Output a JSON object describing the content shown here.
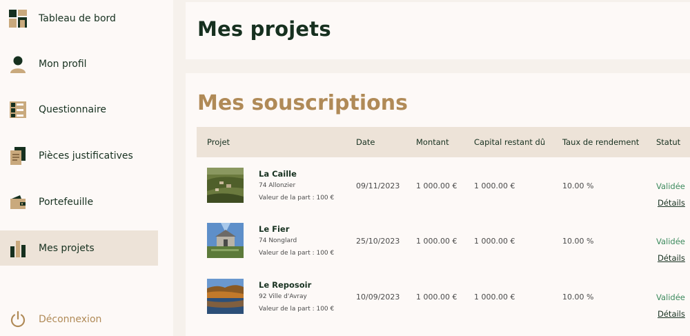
{
  "sidebar": {
    "items": [
      {
        "label": "Tableau de bord",
        "icon": "dashboard-icon"
      },
      {
        "label": "Mon profil",
        "icon": "user-icon"
      },
      {
        "label": "Questionnaire",
        "icon": "questionnaire-icon"
      },
      {
        "label": "Pièces justificatives",
        "icon": "documents-icon"
      },
      {
        "label": "Portefeuille",
        "icon": "wallet-icon"
      },
      {
        "label": "Mes projets",
        "icon": "bar-chart-icon",
        "active": true
      }
    ],
    "logout": {
      "label": "Déconnexion",
      "icon": "power-icon"
    }
  },
  "header": {
    "title": "Mes projets"
  },
  "subscriptions": {
    "title": "Mes souscriptions",
    "columns": [
      "Projet",
      "Date",
      "Montant",
      "Capital restant dû",
      "Taux de rendement",
      "Statut"
    ],
    "rows": [
      {
        "name": "La Caille",
        "location": "74 Allonzier",
        "part": "Valeur de la part : 100 €",
        "date": "09/11/2023",
        "amount": "1 000.00 €",
        "capital": "1 000.00 €",
        "rate": "10.00 %",
        "status": "Validée",
        "details": "Détails"
      },
      {
        "name": "Le Fier",
        "location": "74 Nonglard",
        "part": "Valeur de la part : 100 €",
        "date": "25/10/2023",
        "amount": "1 000.00 €",
        "capital": "1 000.00 €",
        "rate": "10.00 %",
        "status": "Validée",
        "details": "Détails"
      },
      {
        "name": "Le Reposoir",
        "location": "92 Ville d'Avray",
        "part": "Valeur de la part : 100 €",
        "date": "10/09/2023",
        "amount": "1 000.00 €",
        "capital": "1 000.00 €",
        "rate": "10.00 %",
        "status": "Validée",
        "details": "Détails"
      }
    ]
  },
  "colors": {
    "dark_green": "#16301f",
    "gold": "#b08a57",
    "beige": "#ede3d8",
    "status_green": "#3c8a5d"
  }
}
